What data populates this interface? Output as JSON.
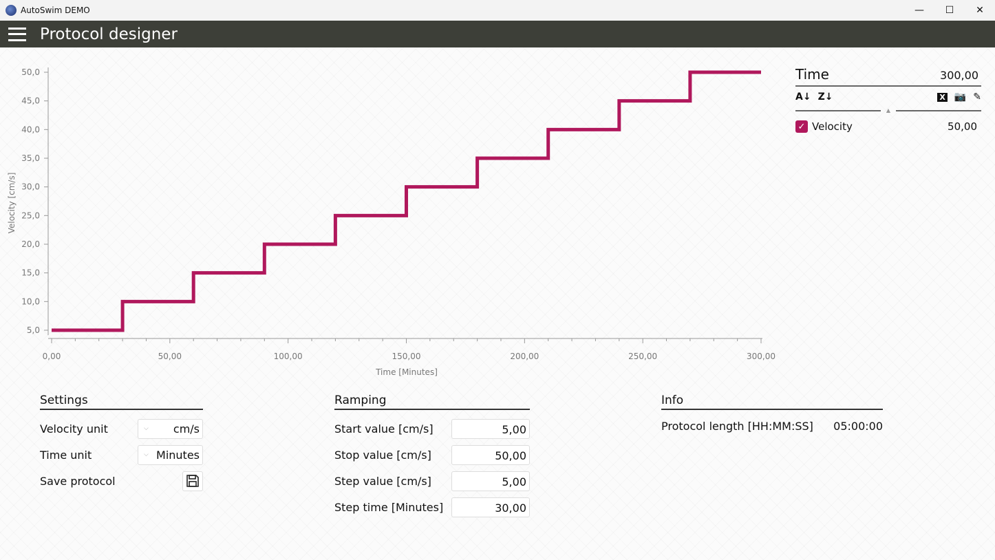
{
  "window": {
    "title": "AutoSwim DEMO",
    "minimize": "—",
    "maximize": "☐",
    "close": "✕"
  },
  "header": {
    "title": "Protocol designer"
  },
  "chart_data": {
    "type": "line",
    "step": true,
    "xlabel": "Time [Minutes]",
    "ylabel": "Velocity [cm/s]",
    "xlim": [
      0,
      300
    ],
    "ylim": [
      5,
      50
    ],
    "xticks": [
      "0,00",
      "50,00",
      "100,00",
      "150,00",
      "200,00",
      "250,00",
      "300,00"
    ],
    "yticks": [
      "5,0",
      "10,0",
      "15,0",
      "20,0",
      "25,0",
      "30,0",
      "35,0",
      "40,0",
      "45,0",
      "50,0"
    ],
    "color": "#b0185c",
    "series": [
      {
        "name": "Velocity",
        "x": [
          0,
          30,
          60,
          90,
          120,
          150,
          180,
          210,
          240,
          270,
          300
        ],
        "y": [
          5,
          10,
          15,
          20,
          25,
          30,
          35,
          40,
          45,
          50,
          50
        ]
      }
    ]
  },
  "legend": {
    "time_label": "Time",
    "time_value": "300,00",
    "items": [
      {
        "name": "Velocity",
        "value": "50,00",
        "checked": true
      }
    ],
    "tools": {
      "sort_asc": "A↓",
      "sort_desc": "Z↓",
      "excel": "X",
      "camera": "📷",
      "brush": "✎"
    }
  },
  "settings": {
    "title": "Settings",
    "velocity_unit_label": "Velocity unit",
    "velocity_unit": "cm/s",
    "time_unit_label": "Time unit",
    "time_unit": "Minutes",
    "save_label": "Save protocol"
  },
  "ramping": {
    "title": "Ramping",
    "rows": [
      {
        "label": "Start value [cm/s]",
        "value": "5,00"
      },
      {
        "label": "Stop value [cm/s]",
        "value": "50,00"
      },
      {
        "label": "Step value [cm/s]",
        "value": "5,00"
      },
      {
        "label": "Step time [Minutes]",
        "value": "30,00"
      }
    ]
  },
  "info": {
    "title": "Info",
    "length_label": "Protocol length [HH:MM:SS]",
    "length_value": "05:00:00"
  }
}
